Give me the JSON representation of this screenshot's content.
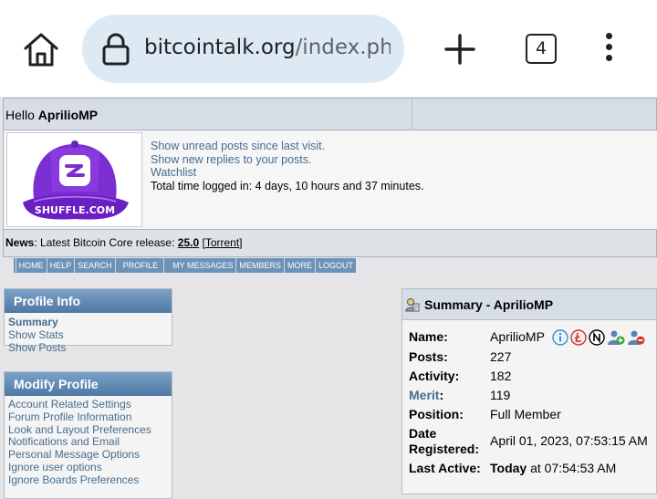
{
  "browser": {
    "url_host": "bitcointalk.org",
    "url_path": "/index.php?",
    "tab_count": "4"
  },
  "header": {
    "greeting": "Hello",
    "username": "AprilioMP"
  },
  "user_panel": {
    "avatar_brand": "SHUFFLE.COM",
    "links": [
      "Show unread posts since last visit.",
      "Show new replies to your posts.",
      "Watchlist"
    ],
    "time_logged_in": "Total time logged in: 4 days, 10 hours and 37 minutes."
  },
  "news": {
    "label": "News",
    "text": ": Latest Bitcoin Core release: ",
    "version": "25.0",
    "torrent": "Torrent"
  },
  "menu": [
    "HOME",
    "HELP",
    "SEARCH",
    "PROFILE",
    "MY MESSAGES",
    "MEMBERS",
    "MORE",
    "LOGOUT"
  ],
  "sidebar": {
    "profile_info": {
      "title": "Profile Info",
      "items": [
        "Summary",
        "Show Stats",
        "Show Posts"
      ]
    },
    "modify_profile": {
      "title": "Modify Profile",
      "items": [
        "Account Related Settings",
        "Forum Profile Information",
        "Look and Layout Preferences",
        "Notifications and Email",
        "Personal Message Options",
        "Ignore user options",
        "Ignore Boards Preferences"
      ]
    }
  },
  "summary": {
    "title": "Summary - AprilioMP",
    "name_label": "Name:",
    "name_value": "AprilioMP",
    "posts_label": "Posts:",
    "posts_value": "227",
    "activity_label": "Activity:",
    "activity_value": "182",
    "merit_label": "Merit",
    "merit_colon": ":",
    "merit_value": "119",
    "position_label": "Position:",
    "position_value": "Full Member",
    "registered_label_1": "Date",
    "registered_label_2": "Registered:",
    "registered_value": "April 01, 2023, 07:53:15 AM",
    "last_active_label": "Last Active:",
    "last_active_today": "Today",
    "last_active_rest": " at 07:54:53 AM"
  },
  "colors": {
    "link": "#476c8e",
    "menubar": "#6d92b8",
    "header_bg": "#d6dde5",
    "avatar_purple": "#7b2fd1"
  }
}
